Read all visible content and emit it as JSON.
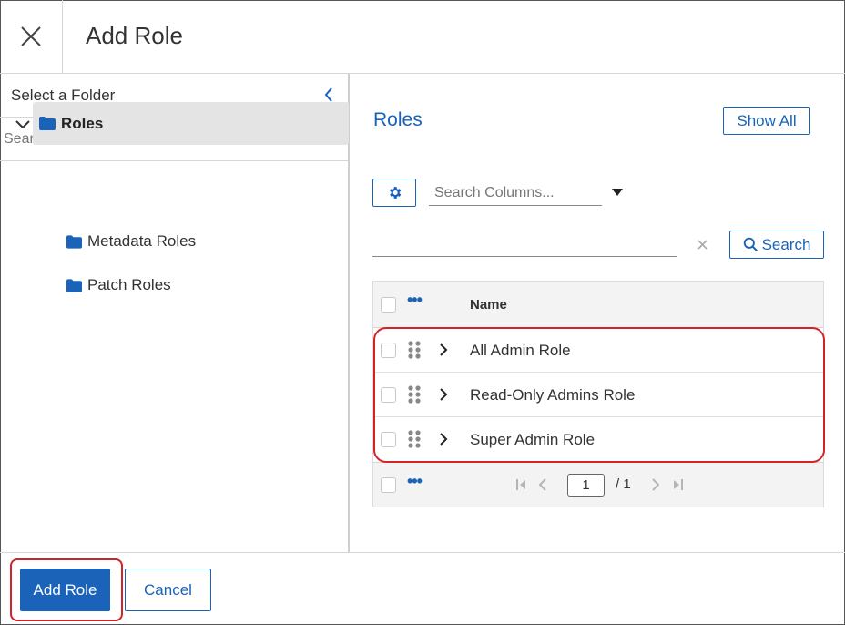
{
  "header": {
    "title": "Add Role",
    "close_icon": "close-icon"
  },
  "folder_panel": {
    "label": "Select a Folder",
    "search_placeholder": "Search...",
    "tree": {
      "root": {
        "label": "Roles",
        "expanded": true,
        "selected": true
      },
      "children": [
        {
          "label": "Metadata Roles"
        },
        {
          "label": "Patch Roles"
        }
      ]
    }
  },
  "roles_panel": {
    "title": "Roles",
    "show_all_label": "Show All",
    "column_search_placeholder": "Search Columns...",
    "filter_value": "",
    "search_label": "Search",
    "grid": {
      "column_header": "Name",
      "rows": [
        {
          "name": "All Admin Role"
        },
        {
          "name": "Read-Only Admins Role"
        },
        {
          "name": "Super Admin Role"
        }
      ],
      "pager": {
        "current_page": "1",
        "total_pages": "/ 1"
      }
    }
  },
  "footer": {
    "primary_label": "Add Role",
    "cancel_label": "Cancel"
  },
  "colors": {
    "accent": "#1a63b8",
    "highlight": "#d32228",
    "folder_icon": "#1a63b8"
  }
}
